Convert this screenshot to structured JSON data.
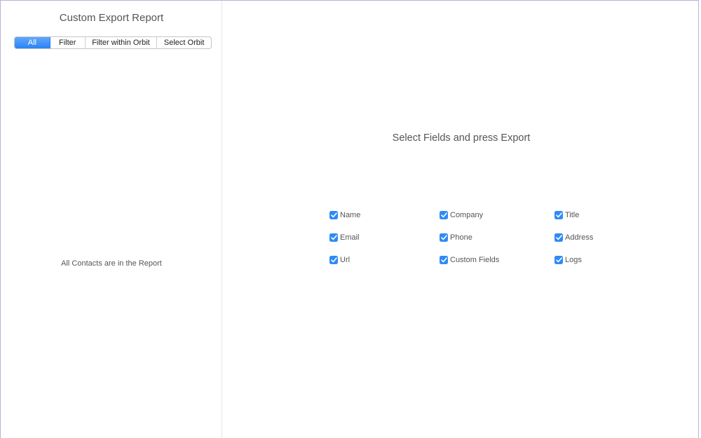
{
  "sidebar": {
    "title": "Custom Export Report",
    "segments": [
      {
        "label": "All",
        "selected": true
      },
      {
        "label": "Filter",
        "selected": false
      },
      {
        "label": "Filter within Orbit",
        "selected": false
      },
      {
        "label": "Select Orbit",
        "selected": false
      }
    ],
    "status": "All Contacts are in the Report"
  },
  "main": {
    "instruction": "Select Fields and press Export",
    "fields": [
      {
        "label": "Name",
        "checked": true
      },
      {
        "label": "Company",
        "checked": true
      },
      {
        "label": "Title",
        "checked": true
      },
      {
        "label": "Email",
        "checked": true
      },
      {
        "label": "Phone",
        "checked": true
      },
      {
        "label": "Address",
        "checked": true
      },
      {
        "label": "Url",
        "checked": true
      },
      {
        "label": "Custom Fields",
        "checked": true
      },
      {
        "label": "Logs",
        "checked": true
      }
    ]
  },
  "colors": {
    "accent": "#2f8bf6",
    "text": "#555555",
    "window_border": "#b8b2d6"
  },
  "icons": {
    "checkbox": "checkmark-icon"
  }
}
